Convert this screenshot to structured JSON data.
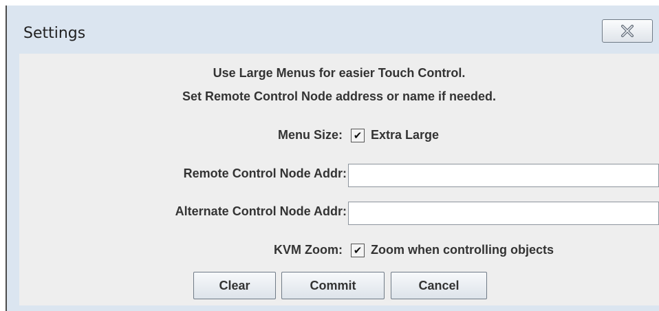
{
  "window": {
    "title": "Settings",
    "close_icon": "close-x-icon"
  },
  "instructions": {
    "line1": "Use Large Menus for easier Touch Control.",
    "line2": "Set Remote Control Node address or name if needed."
  },
  "menu_size": {
    "label": "Menu Size:",
    "checkbox_label": "Extra Large",
    "checked": true
  },
  "remote_addr": {
    "label": "Remote Control Node Addr:",
    "value": ""
  },
  "alternate_addr": {
    "label": "Alternate Control Node Addr:",
    "value": ""
  },
  "kvm_zoom": {
    "label": "KVM Zoom:",
    "checkbox_label": "Zoom when controlling objects",
    "checked": true
  },
  "buttons": {
    "clear": "Clear",
    "commit": "Commit",
    "cancel": "Cancel"
  },
  "colors": {
    "window_frame": "#dbe5f0",
    "content_bg": "#eeeeee",
    "text": "#333333"
  }
}
